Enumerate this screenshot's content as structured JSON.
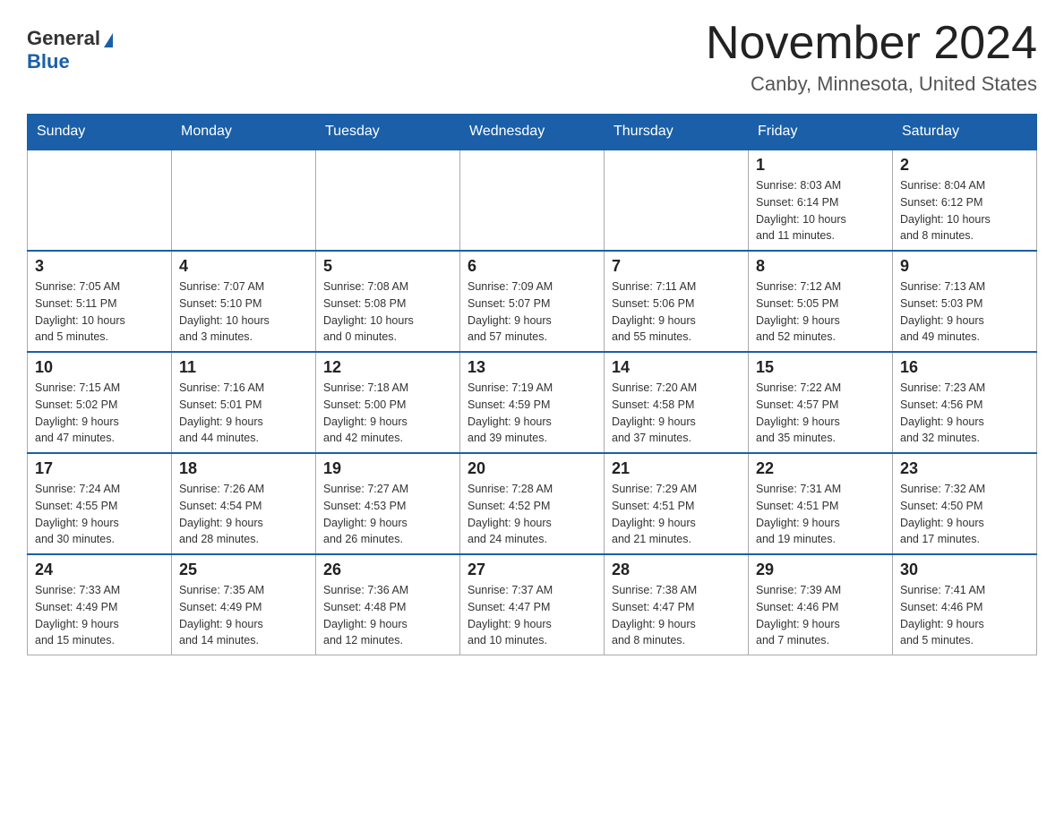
{
  "header": {
    "logo_general": "General",
    "logo_blue": "Blue",
    "month": "November 2024",
    "location": "Canby, Minnesota, United States"
  },
  "days_of_week": [
    "Sunday",
    "Monday",
    "Tuesday",
    "Wednesday",
    "Thursday",
    "Friday",
    "Saturday"
  ],
  "weeks": [
    [
      {
        "day": "",
        "info": ""
      },
      {
        "day": "",
        "info": ""
      },
      {
        "day": "",
        "info": ""
      },
      {
        "day": "",
        "info": ""
      },
      {
        "day": "",
        "info": ""
      },
      {
        "day": "1",
        "info": "Sunrise: 8:03 AM\nSunset: 6:14 PM\nDaylight: 10 hours\nand 11 minutes."
      },
      {
        "day": "2",
        "info": "Sunrise: 8:04 AM\nSunset: 6:12 PM\nDaylight: 10 hours\nand 8 minutes."
      }
    ],
    [
      {
        "day": "3",
        "info": "Sunrise: 7:05 AM\nSunset: 5:11 PM\nDaylight: 10 hours\nand 5 minutes."
      },
      {
        "day": "4",
        "info": "Sunrise: 7:07 AM\nSunset: 5:10 PM\nDaylight: 10 hours\nand 3 minutes."
      },
      {
        "day": "5",
        "info": "Sunrise: 7:08 AM\nSunset: 5:08 PM\nDaylight: 10 hours\nand 0 minutes."
      },
      {
        "day": "6",
        "info": "Sunrise: 7:09 AM\nSunset: 5:07 PM\nDaylight: 9 hours\nand 57 minutes."
      },
      {
        "day": "7",
        "info": "Sunrise: 7:11 AM\nSunset: 5:06 PM\nDaylight: 9 hours\nand 55 minutes."
      },
      {
        "day": "8",
        "info": "Sunrise: 7:12 AM\nSunset: 5:05 PM\nDaylight: 9 hours\nand 52 minutes."
      },
      {
        "day": "9",
        "info": "Sunrise: 7:13 AM\nSunset: 5:03 PM\nDaylight: 9 hours\nand 49 minutes."
      }
    ],
    [
      {
        "day": "10",
        "info": "Sunrise: 7:15 AM\nSunset: 5:02 PM\nDaylight: 9 hours\nand 47 minutes."
      },
      {
        "day": "11",
        "info": "Sunrise: 7:16 AM\nSunset: 5:01 PM\nDaylight: 9 hours\nand 44 minutes."
      },
      {
        "day": "12",
        "info": "Sunrise: 7:18 AM\nSunset: 5:00 PM\nDaylight: 9 hours\nand 42 minutes."
      },
      {
        "day": "13",
        "info": "Sunrise: 7:19 AM\nSunset: 4:59 PM\nDaylight: 9 hours\nand 39 minutes."
      },
      {
        "day": "14",
        "info": "Sunrise: 7:20 AM\nSunset: 4:58 PM\nDaylight: 9 hours\nand 37 minutes."
      },
      {
        "day": "15",
        "info": "Sunrise: 7:22 AM\nSunset: 4:57 PM\nDaylight: 9 hours\nand 35 minutes."
      },
      {
        "day": "16",
        "info": "Sunrise: 7:23 AM\nSunset: 4:56 PM\nDaylight: 9 hours\nand 32 minutes."
      }
    ],
    [
      {
        "day": "17",
        "info": "Sunrise: 7:24 AM\nSunset: 4:55 PM\nDaylight: 9 hours\nand 30 minutes."
      },
      {
        "day": "18",
        "info": "Sunrise: 7:26 AM\nSunset: 4:54 PM\nDaylight: 9 hours\nand 28 minutes."
      },
      {
        "day": "19",
        "info": "Sunrise: 7:27 AM\nSunset: 4:53 PM\nDaylight: 9 hours\nand 26 minutes."
      },
      {
        "day": "20",
        "info": "Sunrise: 7:28 AM\nSunset: 4:52 PM\nDaylight: 9 hours\nand 24 minutes."
      },
      {
        "day": "21",
        "info": "Sunrise: 7:29 AM\nSunset: 4:51 PM\nDaylight: 9 hours\nand 21 minutes."
      },
      {
        "day": "22",
        "info": "Sunrise: 7:31 AM\nSunset: 4:51 PM\nDaylight: 9 hours\nand 19 minutes."
      },
      {
        "day": "23",
        "info": "Sunrise: 7:32 AM\nSunset: 4:50 PM\nDaylight: 9 hours\nand 17 minutes."
      }
    ],
    [
      {
        "day": "24",
        "info": "Sunrise: 7:33 AM\nSunset: 4:49 PM\nDaylight: 9 hours\nand 15 minutes."
      },
      {
        "day": "25",
        "info": "Sunrise: 7:35 AM\nSunset: 4:49 PM\nDaylight: 9 hours\nand 14 minutes."
      },
      {
        "day": "26",
        "info": "Sunrise: 7:36 AM\nSunset: 4:48 PM\nDaylight: 9 hours\nand 12 minutes."
      },
      {
        "day": "27",
        "info": "Sunrise: 7:37 AM\nSunset: 4:47 PM\nDaylight: 9 hours\nand 10 minutes."
      },
      {
        "day": "28",
        "info": "Sunrise: 7:38 AM\nSunset: 4:47 PM\nDaylight: 9 hours\nand 8 minutes."
      },
      {
        "day": "29",
        "info": "Sunrise: 7:39 AM\nSunset: 4:46 PM\nDaylight: 9 hours\nand 7 minutes."
      },
      {
        "day": "30",
        "info": "Sunrise: 7:41 AM\nSunset: 4:46 PM\nDaylight: 9 hours\nand 5 minutes."
      }
    ]
  ]
}
